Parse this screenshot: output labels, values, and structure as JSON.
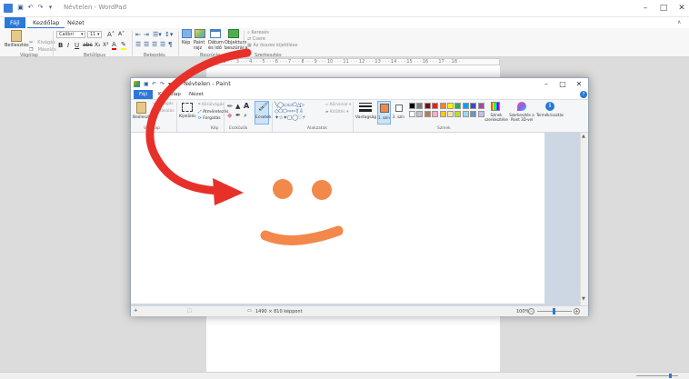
{
  "wordpad": {
    "title": "Névtelen - WordPad",
    "tabs": [
      "Fájl",
      "Kezdőlap",
      "Nézet"
    ],
    "ribbon": {
      "clipboard": {
        "paste": "Beillesztés",
        "cut": "Kivágás",
        "copy": "Másolás",
        "label": "Vágólap"
      },
      "font": {
        "name": "Calibri",
        "size": "11",
        "label": "Betűtípus"
      },
      "paragraph": {
        "label": "Bekezdés"
      },
      "insert": {
        "picture": "Kép",
        "paint": "Paint rajz",
        "datetime": "Dátum és idő",
        "object": "Objektum beszúrása",
        "label": "Beszúrás"
      },
      "editing": {
        "find": "Keresés",
        "replace": "Csere",
        "select_all": "Az összes kijelölése",
        "label": "Szerkesztés"
      }
    },
    "ruler": "· 1 · · · 2 · · · 3 · · · 4 · · · 5 · · · 6 · · · 7 · · · 8 · · · 9 · · · 10 · · · 11 · · · 12 · · · 13 · · · 14 · · · 15 · · · 16 · · · 17 · · 18 ·"
  },
  "paint": {
    "title": "Névtelen - Paint",
    "tabs": [
      "Fájl",
      "Kezdőlap",
      "Nézet"
    ],
    "ribbon": {
      "clipboard": {
        "paste": "Beillesztés",
        "cut": "Kivágás",
        "copy": "Másolás",
        "label": "Vágólap"
      },
      "image": {
        "select": "Kijelölés",
        "crop": "Körülvágás",
        "resize": "Átméretezés",
        "rotate": "Forgatás",
        "label": "Kép"
      },
      "tools": {
        "label": "Eszközök"
      },
      "brushes": {
        "label": "Ecsetek"
      },
      "shapes": {
        "outline": "Körvonal",
        "fill": "Kitöltés",
        "label": "Alakzatok"
      },
      "size": {
        "label": "Vastagság"
      },
      "colors": {
        "color1": "1. szín",
        "color2": "2. szín",
        "edit": "Színek szerkesztése",
        "paint3d": "Szerkesztés a Paint 3D-vel",
        "alert": "Termékriasztás",
        "label": "Színek"
      }
    },
    "status": {
      "size": "1490 × 810 képpont",
      "zoom": "100%"
    }
  },
  "colors": {
    "accent": "#2b78d6",
    "drawing": "#f2894a",
    "arrow": "#e8302a"
  },
  "palette": [
    "#000000",
    "#7f7f7f",
    "#880015",
    "#ed1c24",
    "#ff7f27",
    "#fff200",
    "#22b14c",
    "#00a2e8",
    "#3f48cc",
    "#a349a4",
    "#ffffff",
    "#c3c3c3",
    "#b97a57",
    "#ffaec9",
    "#ffc90e",
    "#efe4b0",
    "#b5e61d",
    "#99d9ea",
    "#7092be",
    "#c8bfe7"
  ]
}
